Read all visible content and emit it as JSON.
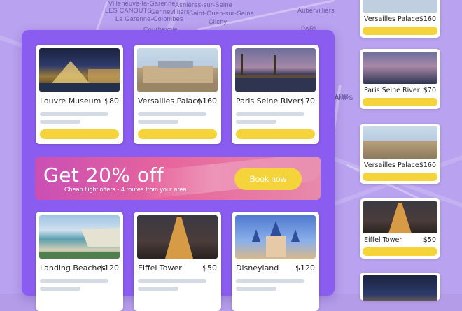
{
  "map": {
    "labels": [
      "Asnières-sur-Seine",
      "Villeneuve-la-Garenne",
      "LES CANOUTS",
      "Gennevilliers",
      "Saint-Ouen-sur-Seine",
      "La Garenne-Colombes",
      "Clichy",
      "Courbevoie",
      "Aubervilliers",
      "PARI",
      "AMPS",
      "ARR."
    ]
  },
  "cards_main": [
    {
      "title": "Louvre Museum",
      "price": "$80"
    },
    {
      "title": "Versailles Palace",
      "price": "$160"
    },
    {
      "title": "Paris Seine River",
      "price": "$70"
    },
    {
      "title": "Landing Beaches",
      "price": "$120"
    },
    {
      "title": "Eiffel Tower",
      "price": "$50"
    },
    {
      "title": "Disneyland",
      "price": "$120"
    }
  ],
  "cards_side": [
    {
      "title": "Versailles Palace",
      "price": "$160"
    },
    {
      "title": "Paris Seine River",
      "price": "$70"
    },
    {
      "title": "Versailles Palace",
      "price": "$160"
    },
    {
      "title": "Eiffel Tower",
      "price": "$50"
    }
  ],
  "banner": {
    "headline": "Get 20% off",
    "subtitle": "Cheap flight offers - 4 routes from your area",
    "cta": "Book now"
  },
  "colors": {
    "panel": "#8b5cf0",
    "button": "#f5d33a",
    "banner_start": "#c94fb4",
    "banner_end": "#e78aaa"
  }
}
